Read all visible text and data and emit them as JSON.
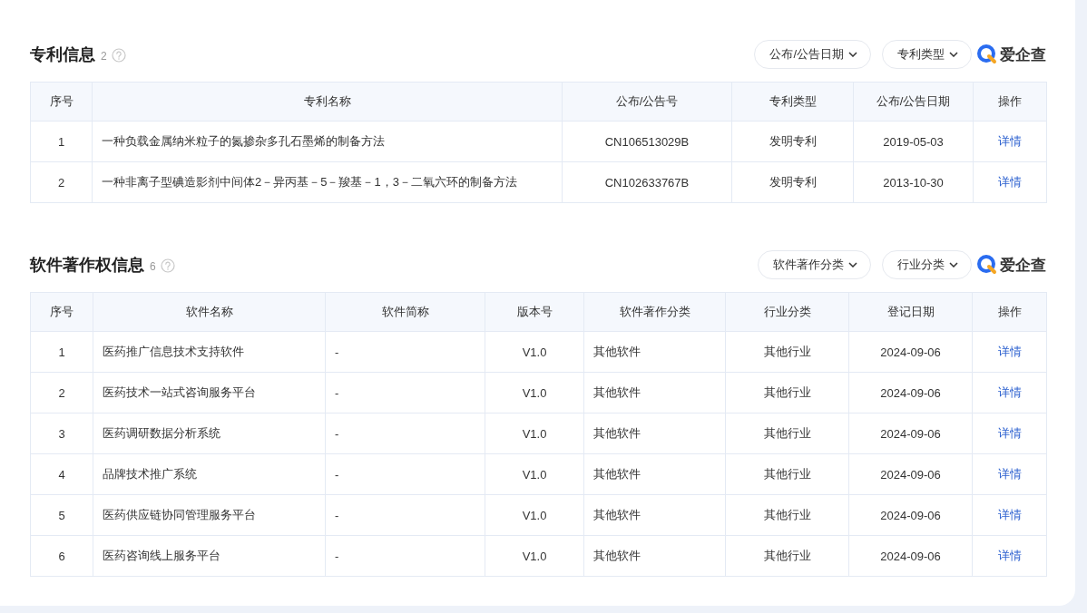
{
  "sections": [
    {
      "title": "专利信息",
      "count": "2",
      "filters": [
        "公布/公告日期",
        "专利类型"
      ],
      "logo_text": "爱企查",
      "columns": [
        "序号",
        "专利名称",
        "公布/公告号",
        "专利类型",
        "公布/公告日期",
        "操作"
      ],
      "rows": [
        {
          "cells": [
            "1",
            "一种负载金属纳米粒子的氮掺杂多孔石墨烯的制备方法",
            "CN106513029B",
            "发明专利",
            "2019-05-03"
          ],
          "action": "详情"
        },
        {
          "cells": [
            "2",
            "一种非离子型碘造影剂中间体2－异丙基－5－羧基－1，3－二氧六环的制备方法",
            "CN102633767B",
            "发明专利",
            "2013-10-30"
          ],
          "action": "详情"
        }
      ]
    },
    {
      "title": "软件著作权信息",
      "count": "6",
      "filters": [
        "软件著作分类",
        "行业分类"
      ],
      "logo_text": "爱企查",
      "columns": [
        "序号",
        "软件名称",
        "软件简称",
        "版本号",
        "软件著作分类",
        "行业分类",
        "登记日期",
        "操作"
      ],
      "rows": [
        {
          "cells": [
            "1",
            "医药推广信息技术支持软件",
            "-",
            "V1.0",
            "其他软件",
            "其他行业",
            "2024-09-06"
          ],
          "action": "详情"
        },
        {
          "cells": [
            "2",
            "医药技术一站式咨询服务平台",
            "-",
            "V1.0",
            "其他软件",
            "其他行业",
            "2024-09-06"
          ],
          "action": "详情"
        },
        {
          "cells": [
            "3",
            "医药调研数据分析系统",
            "-",
            "V1.0",
            "其他软件",
            "其他行业",
            "2024-09-06"
          ],
          "action": "详情"
        },
        {
          "cells": [
            "4",
            "品牌技术推广系统",
            "-",
            "V1.0",
            "其他软件",
            "其他行业",
            "2024-09-06"
          ],
          "action": "详情"
        },
        {
          "cells": [
            "5",
            "医药供应链协同管理服务平台",
            "-",
            "V1.0",
            "其他软件",
            "其他行业",
            "2024-09-06"
          ],
          "action": "详情"
        },
        {
          "cells": [
            "6",
            "医药咨询线上服务平台",
            "-",
            "V1.0",
            "其他软件",
            "其他行业",
            "2024-09-06"
          ],
          "action": "详情"
        }
      ]
    }
  ]
}
